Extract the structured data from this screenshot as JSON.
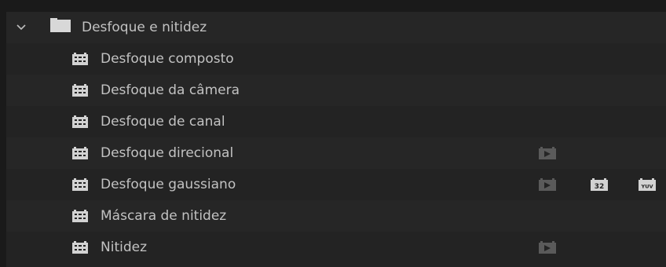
{
  "folder": {
    "label": "Desfoque e nitidez",
    "expanded": true,
    "chevron_icon": "chevron-down-icon",
    "folder_icon": "folder-icon"
  },
  "effects": [
    {
      "label": "Desfoque composto",
      "accelerated": false,
      "bit32": false,
      "yuv": false
    },
    {
      "label": "Desfoque da câmera",
      "accelerated": false,
      "bit32": false,
      "yuv": false
    },
    {
      "label": "Desfoque de canal",
      "accelerated": false,
      "bit32": false,
      "yuv": false
    },
    {
      "label": "Desfoque direcional",
      "accelerated": true,
      "bit32": false,
      "yuv": false
    },
    {
      "label": "Desfoque gaussiano",
      "accelerated": true,
      "bit32": true,
      "yuv": true
    },
    {
      "label": "Máscara de nitidez",
      "accelerated": false,
      "bit32": false,
      "yuv": false
    },
    {
      "label": "Nitidez",
      "accelerated": true,
      "bit32": false,
      "yuv": false
    }
  ],
  "badges": {
    "accelerated_icon": "accelerated-effect-icon",
    "bit32_label": "32",
    "yuv_label": "YUV"
  },
  "colors": {
    "background": "#232323",
    "row_alt": "#262626",
    "text": "#c2c2c2",
    "icon": "#d2d2d2",
    "badge": "#5a5a5a"
  }
}
